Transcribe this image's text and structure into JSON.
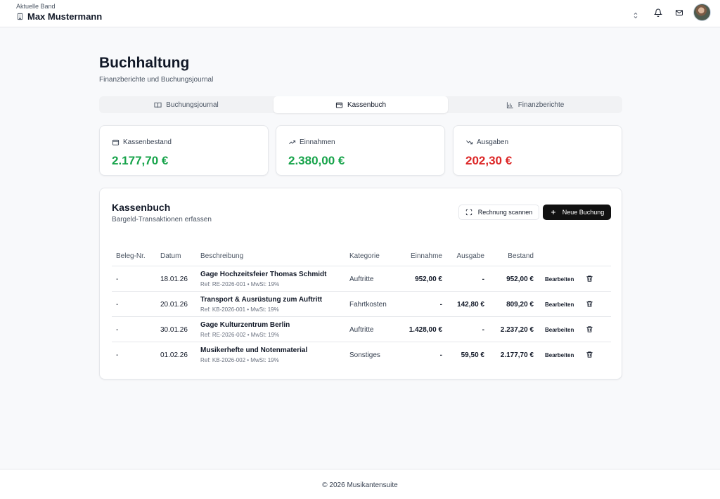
{
  "header": {
    "band_label": "Aktuelle Band",
    "band_name": "Max Mustermann"
  },
  "page": {
    "title": "Buchhaltung",
    "subtitle": "Finanzberichte und Buchungsjournal"
  },
  "tabs": [
    {
      "label": "Buchungsjournal",
      "icon": "book-open-icon",
      "active": false
    },
    {
      "label": "Kassenbuch",
      "icon": "wallet-icon",
      "active": true
    },
    {
      "label": "Finanzberichte",
      "icon": "bar-chart-icon",
      "active": false
    }
  ],
  "stats": [
    {
      "label": "Kassenbestand",
      "value": "2.177,70 €",
      "icon": "wallet-icon",
      "color": "#16a34a"
    },
    {
      "label": "Einnahmen",
      "value": "2.380,00 €",
      "icon": "trending-up-icon",
      "color": "#16a34a"
    },
    {
      "label": "Ausgaben",
      "value": "202,30 €",
      "icon": "trending-down-icon",
      "color": "#dc2626"
    }
  ],
  "card": {
    "title": "Kassenbuch",
    "subtitle": "Bargeld-Transaktionen erfassen",
    "scan_label": "Rechnung scannen",
    "new_label": "Neue Buchung"
  },
  "table": {
    "columns": [
      "Beleg-Nr.",
      "Datum",
      "Beschreibung",
      "Kategorie",
      "Einnahme",
      "Ausgabe",
      "Bestand"
    ],
    "edit_label": "Bearbeiten",
    "rows": [
      {
        "beleg": "-",
        "datum": "18.01.26",
        "beschreibung": "Gage Hochzeitsfeier Thomas Schmidt",
        "ref": "Ref: RE-2026-001 • MwSt: 19%",
        "kategorie": "Auftritte",
        "einnahme": "952,00 €",
        "ausgabe": "-",
        "bestand": "952,00 €"
      },
      {
        "beleg": "-",
        "datum": "20.01.26",
        "beschreibung": "Transport & Ausrüstung zum Auftritt",
        "ref": "Ref: KB-2026-001 • MwSt: 19%",
        "kategorie": "Fahrtkosten",
        "einnahme": "-",
        "ausgabe": "142,80 €",
        "bestand": "809,20 €"
      },
      {
        "beleg": "-",
        "datum": "30.01.26",
        "beschreibung": "Gage Kulturzentrum Berlin",
        "ref": "Ref: RE-2026-002 • MwSt: 19%",
        "kategorie": "Auftritte",
        "einnahme": "1.428,00 €",
        "ausgabe": "-",
        "bestand": "2.237,20 €"
      },
      {
        "beleg": "-",
        "datum": "01.02.26",
        "beschreibung": "Musikerhefte und Notenmaterial",
        "ref": "Ref: KB-2026-002 • MwSt: 19%",
        "kategorie": "Sonstiges",
        "einnahme": "-",
        "ausgabe": "59,50 €",
        "bestand": "2.177,70 €"
      }
    ]
  },
  "footer": {
    "text": "© 2026 Musikantensuite"
  },
  "colors": {
    "income": "#16a34a",
    "expense": "#dc2626",
    "primary_button": "#111111"
  }
}
